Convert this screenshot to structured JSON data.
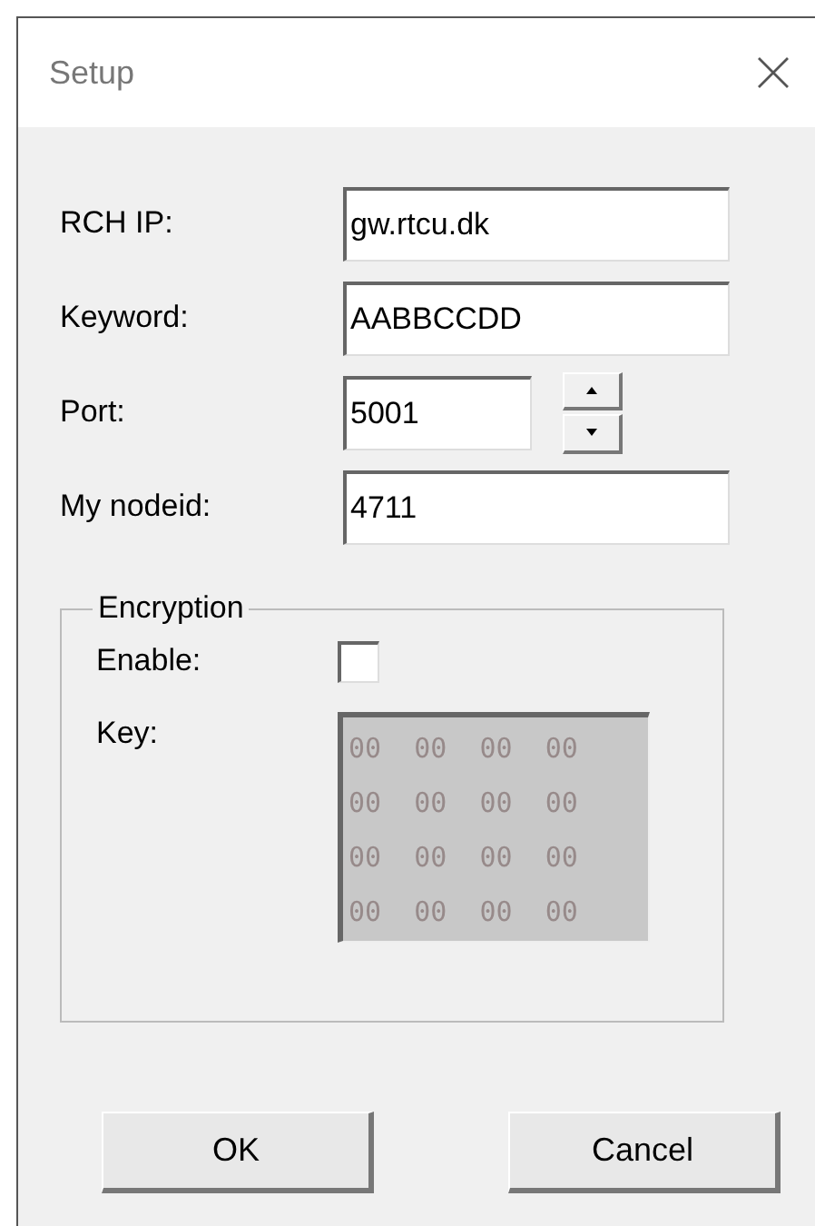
{
  "window": {
    "title": "Setup"
  },
  "fields": [
    {
      "label": "RCH IP:",
      "value": "gw.rtcu.dk",
      "kind": "text"
    },
    {
      "label": "Keyword:",
      "value": "AABBCCDD",
      "kind": "text"
    },
    {
      "label": "Port:",
      "value": "5001",
      "kind": "spin"
    },
    {
      "label": "My nodeid:",
      "value": "4711",
      "kind": "text"
    }
  ],
  "encryption": {
    "title": "Encryption",
    "enable": {
      "label": "Enable:",
      "checked": false
    },
    "key": {
      "label": "Key:",
      "disabled": true,
      "lines": [
        "00  00  00  00",
        "00  00  00  00",
        "00  00  00  00",
        "00  00  00  00"
      ]
    }
  },
  "buttons": [
    {
      "label": "OK"
    },
    {
      "label": "Cancel"
    }
  ]
}
